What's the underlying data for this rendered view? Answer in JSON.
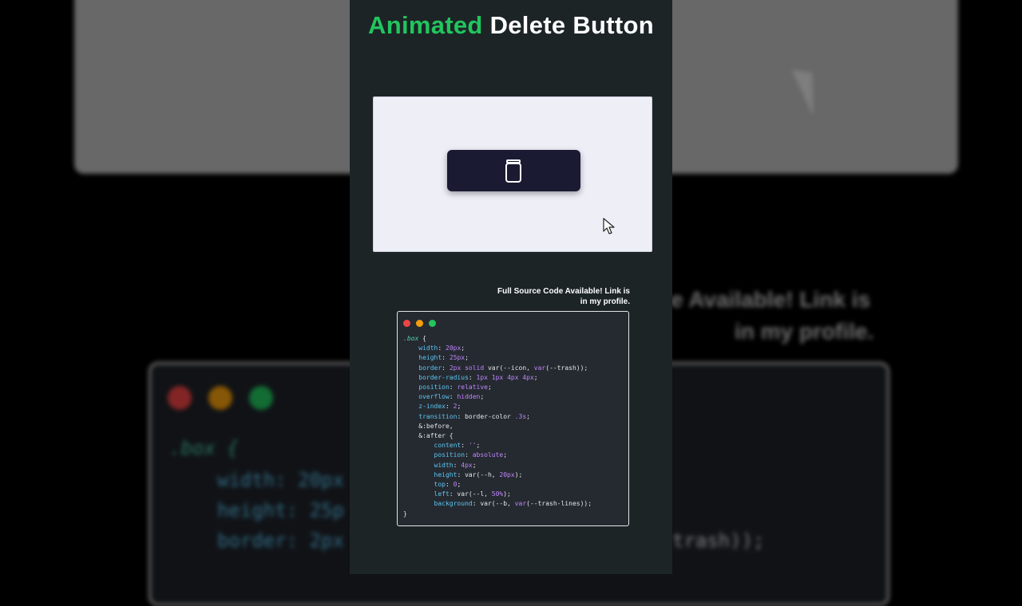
{
  "title": {
    "accent": "Animated",
    "rest": " Delete Button"
  },
  "background": {
    "note_line1": "e Available! Link is",
    "note_line2": "in my profile.",
    "code_sel": ".box {",
    "code_w": "width: 20px",
    "code_h": "height: 25p",
    "code_b": "border: 2px",
    "code_tail": "trash));"
  },
  "preview": {
    "button_icon": "trash-icon",
    "cursor_icon": "cursor-icon"
  },
  "source_note": {
    "line1": "Full Source Code Available! Link is",
    "line2": "in my profile."
  },
  "editor": {
    "dots": [
      "#ef4444",
      "#f59e0b",
      "#22c55e"
    ],
    "lines": [
      [
        {
          "t": ".box",
          "c": "c-sel"
        },
        {
          "t": " {",
          "c": "c-plain"
        }
      ],
      [
        {
          "t": "    width",
          "c": "c-prop"
        },
        {
          "t": ": ",
          "c": "c-plain"
        },
        {
          "t": "20px",
          "c": "c-val"
        },
        {
          "t": ";",
          "c": "c-plain"
        }
      ],
      [
        {
          "t": "    height",
          "c": "c-prop"
        },
        {
          "t": ": ",
          "c": "c-plain"
        },
        {
          "t": "25px",
          "c": "c-val"
        },
        {
          "t": ";",
          "c": "c-plain"
        }
      ],
      [
        {
          "t": "    border",
          "c": "c-prop"
        },
        {
          "t": ": ",
          "c": "c-plain"
        },
        {
          "t": "2px solid",
          "c": "c-val"
        },
        {
          "t": " var(--icon, ",
          "c": "c-plain"
        },
        {
          "t": "var",
          "c": "c-val"
        },
        {
          "t": "(--trash));",
          "c": "c-plain"
        }
      ],
      [
        {
          "t": "    border-radius",
          "c": "c-prop"
        },
        {
          "t": ": ",
          "c": "c-plain"
        },
        {
          "t": "1px 1px 4px 4px",
          "c": "c-val"
        },
        {
          "t": ";",
          "c": "c-plain"
        }
      ],
      [
        {
          "t": "    position",
          "c": "c-prop"
        },
        {
          "t": ": ",
          "c": "c-plain"
        },
        {
          "t": "relative",
          "c": "c-val"
        },
        {
          "t": ";",
          "c": "c-plain"
        }
      ],
      [
        {
          "t": "    overflow",
          "c": "c-prop"
        },
        {
          "t": ": ",
          "c": "c-plain"
        },
        {
          "t": "hidden",
          "c": "c-val"
        },
        {
          "t": ";",
          "c": "c-plain"
        }
      ],
      [
        {
          "t": "    z-index",
          "c": "c-prop"
        },
        {
          "t": ": ",
          "c": "c-plain"
        },
        {
          "t": "2",
          "c": "c-val"
        },
        {
          "t": ";",
          "c": "c-plain"
        }
      ],
      [
        {
          "t": "    transition",
          "c": "c-prop"
        },
        {
          "t": ": border-color ",
          "c": "c-plain"
        },
        {
          "t": ".3s",
          "c": "c-val"
        },
        {
          "t": ";",
          "c": "c-plain"
        }
      ],
      [
        {
          "t": "    &:before,",
          "c": "c-plain"
        }
      ],
      [
        {
          "t": "    &:after {",
          "c": "c-plain"
        }
      ],
      [
        {
          "t": "        content",
          "c": "c-prop"
        },
        {
          "t": ": ",
          "c": "c-plain"
        },
        {
          "t": "''",
          "c": "c-val"
        },
        {
          "t": ";",
          "c": "c-plain"
        }
      ],
      [
        {
          "t": "        position",
          "c": "c-prop"
        },
        {
          "t": ": ",
          "c": "c-plain"
        },
        {
          "t": "absolute",
          "c": "c-val"
        },
        {
          "t": ";",
          "c": "c-plain"
        }
      ],
      [
        {
          "t": "        width",
          "c": "c-prop"
        },
        {
          "t": ": ",
          "c": "c-plain"
        },
        {
          "t": "4px",
          "c": "c-val"
        },
        {
          "t": ";",
          "c": "c-plain"
        }
      ],
      [
        {
          "t": "        height",
          "c": "c-prop"
        },
        {
          "t": ": var(--h, ",
          "c": "c-plain"
        },
        {
          "t": "20px",
          "c": "c-val"
        },
        {
          "t": ");",
          "c": "c-plain"
        }
      ],
      [
        {
          "t": "        top",
          "c": "c-prop"
        },
        {
          "t": ": ",
          "c": "c-plain"
        },
        {
          "t": "0",
          "c": "c-val"
        },
        {
          "t": ";",
          "c": "c-plain"
        }
      ],
      [
        {
          "t": "        left",
          "c": "c-prop"
        },
        {
          "t": ": var(--l, ",
          "c": "c-plain"
        },
        {
          "t": "50%",
          "c": "c-val"
        },
        {
          "t": ");",
          "c": "c-plain"
        }
      ],
      [
        {
          "t": "        background",
          "c": "c-prop"
        },
        {
          "t": ": var(--b, ",
          "c": "c-plain"
        },
        {
          "t": "var",
          "c": "c-val"
        },
        {
          "t": "(--trash-lines));",
          "c": "c-plain"
        }
      ],
      [
        {
          "t": "}",
          "c": "c-plain"
        }
      ]
    ]
  }
}
